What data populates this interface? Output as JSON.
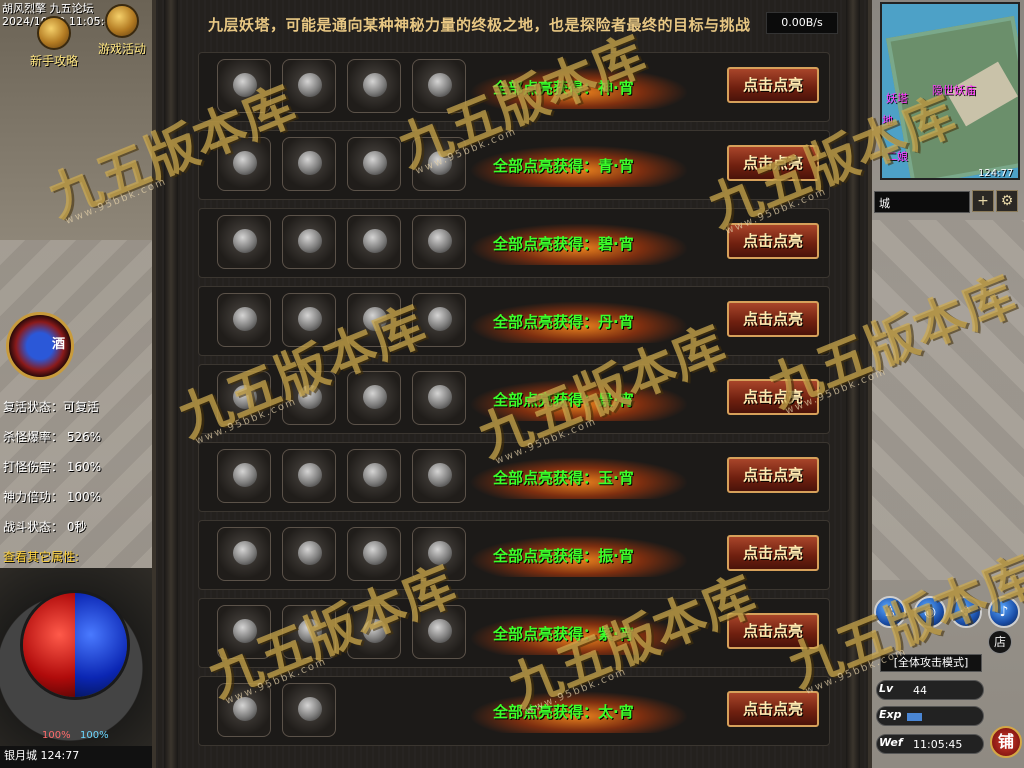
{
  "left_hud": {
    "clock_line1": "胡风烈擎 九五论坛",
    "clock_line2": "2024/10/09 11:05:45",
    "btn_newbie": "新手攻略",
    "btn_activity": "游戏活动",
    "emblem_text": "酒",
    "stats": [
      "复活状态：可复活",
      "杀怪爆率： 526%",
      "打怪伤害： 160%",
      "神力倍功： 100%",
      "战斗状态：  0秒"
    ],
    "other_attrs_link": "查看其它属性:",
    "hp_pct": "100%",
    "mp_pct": "100%",
    "location": "银月城 124:77"
  },
  "panel": {
    "title": "九层妖塔，可能是通向某种神秘力量的终极之地，也是探险者最终的目标与挑战",
    "net_speed": "0.00B/s",
    "rows": [
      {
        "reward": "全部点亮获得：神·宵",
        "button": "点击点亮",
        "slots": 4
      },
      {
        "reward": "全部点亮获得：青·宵",
        "button": "点击点亮",
        "slots": 4
      },
      {
        "reward": "全部点亮获得：碧·宵",
        "button": "点击点亮",
        "slots": 4
      },
      {
        "reward": "全部点亮获得：丹·宵",
        "button": "点击点亮",
        "slots": 4
      },
      {
        "reward": "全部点亮获得：景·宵",
        "button": "点击点亮",
        "slots": 4
      },
      {
        "reward": "全部点亮获得：玉·宵",
        "button": "点击点亮",
        "slots": 4
      },
      {
        "reward": "全部点亮获得：振·宵",
        "button": "点击点亮",
        "slots": 4
      },
      {
        "reward": "全部点亮获得：紫·宵",
        "button": "点击点亮",
        "slots": 4
      },
      {
        "reward": "全部点亮获得：太·宵",
        "button": "点击点亮",
        "slots": 2
      }
    ]
  },
  "right_hud": {
    "minimap_labels": [
      "隐世妖庙",
      "妖塔",
      "地",
      "二娘"
    ],
    "coord": "124:77",
    "search_value": "城",
    "btn_plus": "+",
    "btn_gear": "⚙",
    "attack_mode": "[全体攻击模式]",
    "shop_small": "店",
    "lv_tag": "Lv",
    "lv_value": "44",
    "exp_tag": "Exp",
    "exp_fraction": 0.2,
    "wef_tag": "Wef",
    "time": "11:05:45",
    "shop_big": "铺"
  },
  "watermark": {
    "text": "九五版本库",
    "url": "www.95bbk.com"
  }
}
